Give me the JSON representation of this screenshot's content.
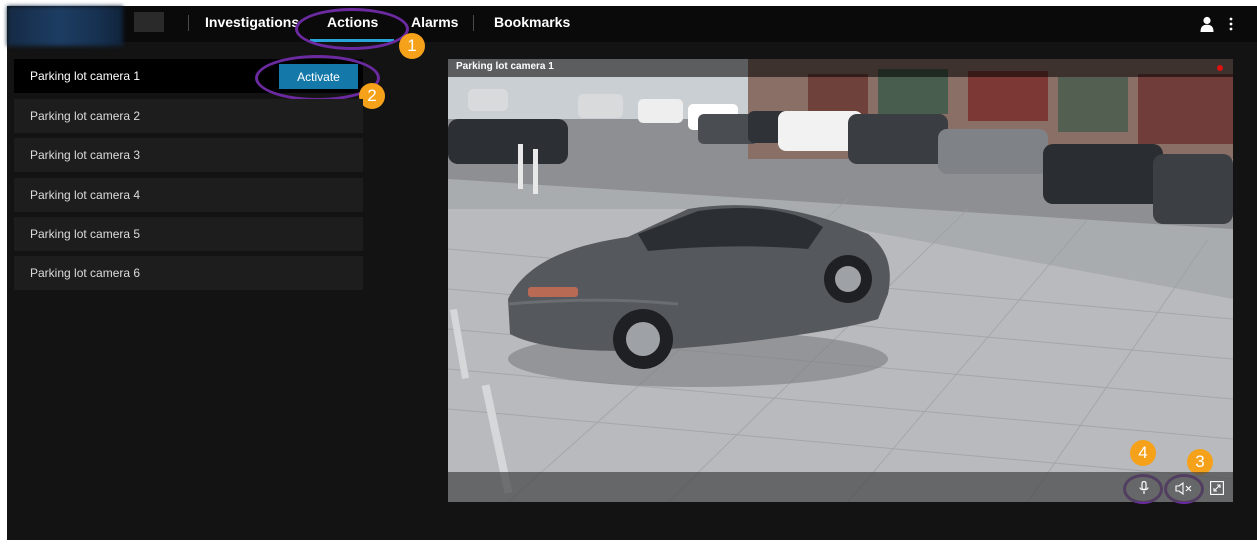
{
  "nav": {
    "tabs": [
      {
        "label": "Investigations"
      },
      {
        "label": "Actions"
      },
      {
        "label": "Alarms"
      },
      {
        "label": "Bookmarks"
      }
    ],
    "active_tab": "Actions"
  },
  "cameras": {
    "items": [
      {
        "label": "Parking lot camera 1"
      },
      {
        "label": "Parking lot camera 2"
      },
      {
        "label": "Parking lot camera 3"
      },
      {
        "label": "Parking lot camera 4"
      },
      {
        "label": "Parking lot camera 5"
      },
      {
        "label": "Parking lot camera 6"
      }
    ],
    "activate_label": "Activate"
  },
  "video": {
    "title": "Parking lot camera 1",
    "controls": [
      "microphone-icon",
      "speaker-muted-icon",
      "expand-icon"
    ]
  },
  "callouts": {
    "one": "1",
    "two": "2",
    "three": "3",
    "four": "4"
  },
  "colors": {
    "accent": "#28a4d8",
    "button": "#1479a8",
    "callout_badge": "#f5a11a",
    "callout_ring": "#6b2aa0",
    "recording": "#e01010"
  }
}
